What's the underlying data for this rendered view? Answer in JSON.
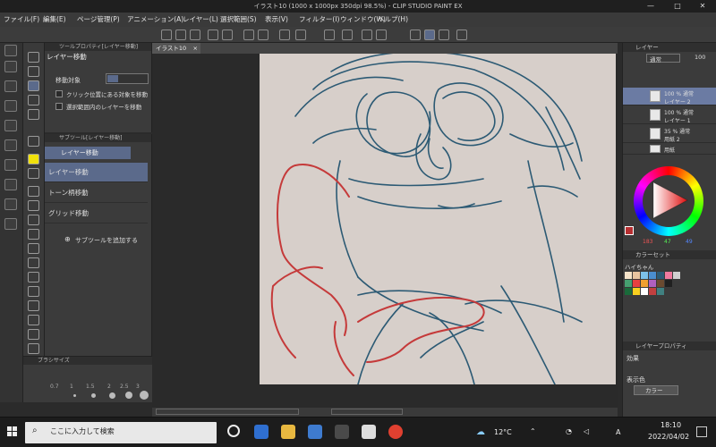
{
  "window": {
    "title": "イラスト10 (1000 x 1000px 350dpi 98.5%) - CLIP STUDIO PAINT EX",
    "controls": [
      "—",
      "□",
      "✕"
    ]
  },
  "menu": [
    "ファイル(F)",
    "編集(E)",
    "ページ管理(P)",
    "アニメーション(A)",
    "レイヤー(L)",
    "選択範囲(S)",
    "表示(V)",
    "フィルター(I)",
    "ウィンドウ(W)",
    "ヘルプ(H)"
  ],
  "canvas_tab": {
    "label": "イラスト10",
    "close": "×"
  },
  "tool_property": {
    "title": "ツールプロパティ[レイヤー移動]",
    "tool_name": "レイヤー移動",
    "target_label": "移動対象",
    "options": [
      "クリック位置にある対象を移動",
      "選択範囲内のレイヤーを移動"
    ]
  },
  "subtool": {
    "title": "サブツール[レイヤー移動]",
    "group_label": "レイヤー移動",
    "items": [
      "レイヤー移動",
      "トーン柄移動",
      "グリッド移動"
    ],
    "add_label": "サブツールを追加する"
  },
  "brush_size": {
    "title": "ブラシサイズ",
    "values": [
      "0.7",
      "1",
      "1.5",
      "2",
      "2.5",
      "3"
    ]
  },
  "layer_panel": {
    "title": "レイヤー",
    "blend_mode": "通常",
    "opacity": "100",
    "layers": [
      {
        "name": "100 % 通常",
        "sub": "レイヤー 2",
        "selected": true
      },
      {
        "name": "100 % 通常",
        "sub": "レイヤー 1",
        "selected": false
      },
      {
        "name": "35 % 通常",
        "sub": "用紙 2",
        "selected": false
      },
      {
        "name": "用紙",
        "sub": "",
        "selected": false
      }
    ]
  },
  "color_wheel": {
    "r": "183",
    "g": "47",
    "b": "49",
    "main_color": "#b72f31"
  },
  "color_set": {
    "title": "カラーセット",
    "name": "ハイちゃん"
  },
  "layer_property": {
    "title": "レイヤープロパティ",
    "effect_label": "効果",
    "display_color_label": "表示色",
    "display_color_value": "カラー"
  },
  "taskbar": {
    "search_placeholder": "ここに入力して検索",
    "weather": "12°C",
    "ime": "A",
    "time": "18:10",
    "date": "2022/04/02"
  },
  "colors": {
    "stroke_blue": "#2c5a74",
    "stroke_red": "#c53a3a",
    "canvas": "#d7cfca",
    "selection": "#5b6a8b"
  }
}
